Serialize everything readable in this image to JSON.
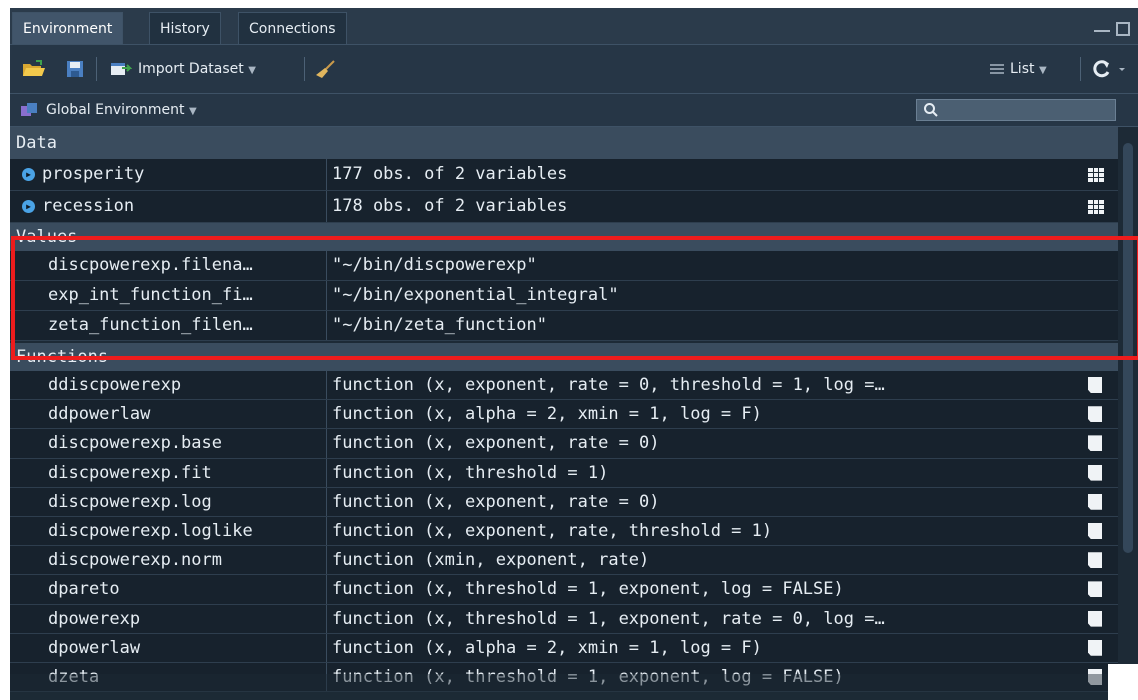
{
  "tabs": [
    {
      "label": "Environment",
      "active": true
    },
    {
      "label": "History",
      "active": false
    },
    {
      "label": "Connections",
      "active": false
    }
  ],
  "toolbar": {
    "import_label": "Import Dataset",
    "view_label": "List",
    "icons": [
      "open-folder-icon",
      "save-icon",
      "import-dataset-icon",
      "broom-icon",
      "list-view-icon",
      "refresh-icon"
    ]
  },
  "env_bar": {
    "scope_label": "Global Environment",
    "search_placeholder": ""
  },
  "sections": {
    "data": "Data",
    "values": "Values",
    "functions": "Functions"
  },
  "data_rows": [
    {
      "name": "prosperity",
      "value": "177 obs. of 2 variables"
    },
    {
      "name": "recession",
      "value": "178 obs. of 2 variables"
    }
  ],
  "value_rows": [
    {
      "name": "discpowerexp.filena…",
      "value": "\"~/bin/discpowerexp\""
    },
    {
      "name": "exp_int_function_fi…",
      "value": "\"~/bin/exponential_integral\""
    },
    {
      "name": "zeta_function_filen…",
      "value": "\"~/bin/zeta_function\""
    }
  ],
  "function_rows": [
    {
      "name": "ddiscpowerexp",
      "value": "function (x, exponent, rate = 0, threshold = 1, log =…"
    },
    {
      "name": "ddpowerlaw",
      "value": "function (x, alpha = 2, xmin = 1, log = F)"
    },
    {
      "name": "discpowerexp.base",
      "value": "function (x, exponent, rate = 0)"
    },
    {
      "name": "discpowerexp.fit",
      "value": "function (x, threshold = 1)"
    },
    {
      "name": "discpowerexp.log",
      "value": "function (x, exponent, rate = 0)"
    },
    {
      "name": "discpowerexp.loglike",
      "value": "function (x, exponent, rate, threshold = 1)"
    },
    {
      "name": "discpowerexp.norm",
      "value": "function (xmin, exponent, rate)"
    },
    {
      "name": "dpareto",
      "value": "function (x, threshold = 1, exponent, log = FALSE)"
    },
    {
      "name": "dpowerexp",
      "value": "function (x, threshold = 1, exponent, rate = 0, log =…"
    },
    {
      "name": "dpowerlaw",
      "value": "function (x, alpha = 2, xmin = 1, log = F)"
    },
    {
      "name": "dzeta",
      "value": "function (x, threshold = 1, exponent, log = FALSE)"
    }
  ],
  "colors": {
    "highlight": "#ee1c1c",
    "expand_icon": "#4aa3e6",
    "background": "#1d2a36"
  }
}
